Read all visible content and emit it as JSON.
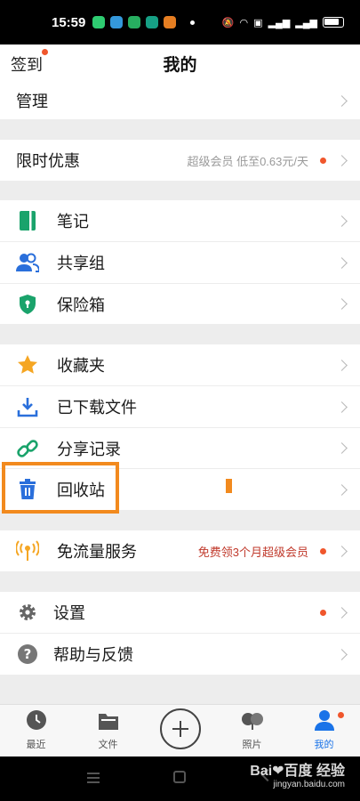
{
  "status_bar": {
    "time": "15:59"
  },
  "header": {
    "signin": "签到",
    "title": "我的"
  },
  "rows": {
    "manage": "管理",
    "promo": {
      "label": "限时优惠",
      "meta": "超级会员 低至0.63元/天"
    },
    "notes": "笔记",
    "share_group": "共享组",
    "vault": "保险箱",
    "favorites": "收藏夹",
    "downloaded": "已下载文件",
    "share_record": "分享记录",
    "recycle": "回收站",
    "free_traffic": {
      "label": "免流量服务",
      "meta": "免费领3个月超级会员"
    },
    "settings": "设置",
    "help": "帮助与反馈"
  },
  "tabs": [
    {
      "label": "最近",
      "icon": "clock-icon"
    },
    {
      "label": "文件",
      "icon": "folder-icon"
    },
    {
      "label": "",
      "icon": "plus-icon"
    },
    {
      "label": "照片",
      "icon": "photo-icon"
    },
    {
      "label": "我的",
      "icon": "user-icon"
    }
  ],
  "watermark": {
    "brand": "Bai❤百度 经验",
    "url": "jingyan.baidu.com"
  },
  "colors": {
    "accent": "#1a73e8",
    "red_dot": "#f0562c",
    "highlight": "#f28a1e",
    "green": "#1aa36b"
  }
}
